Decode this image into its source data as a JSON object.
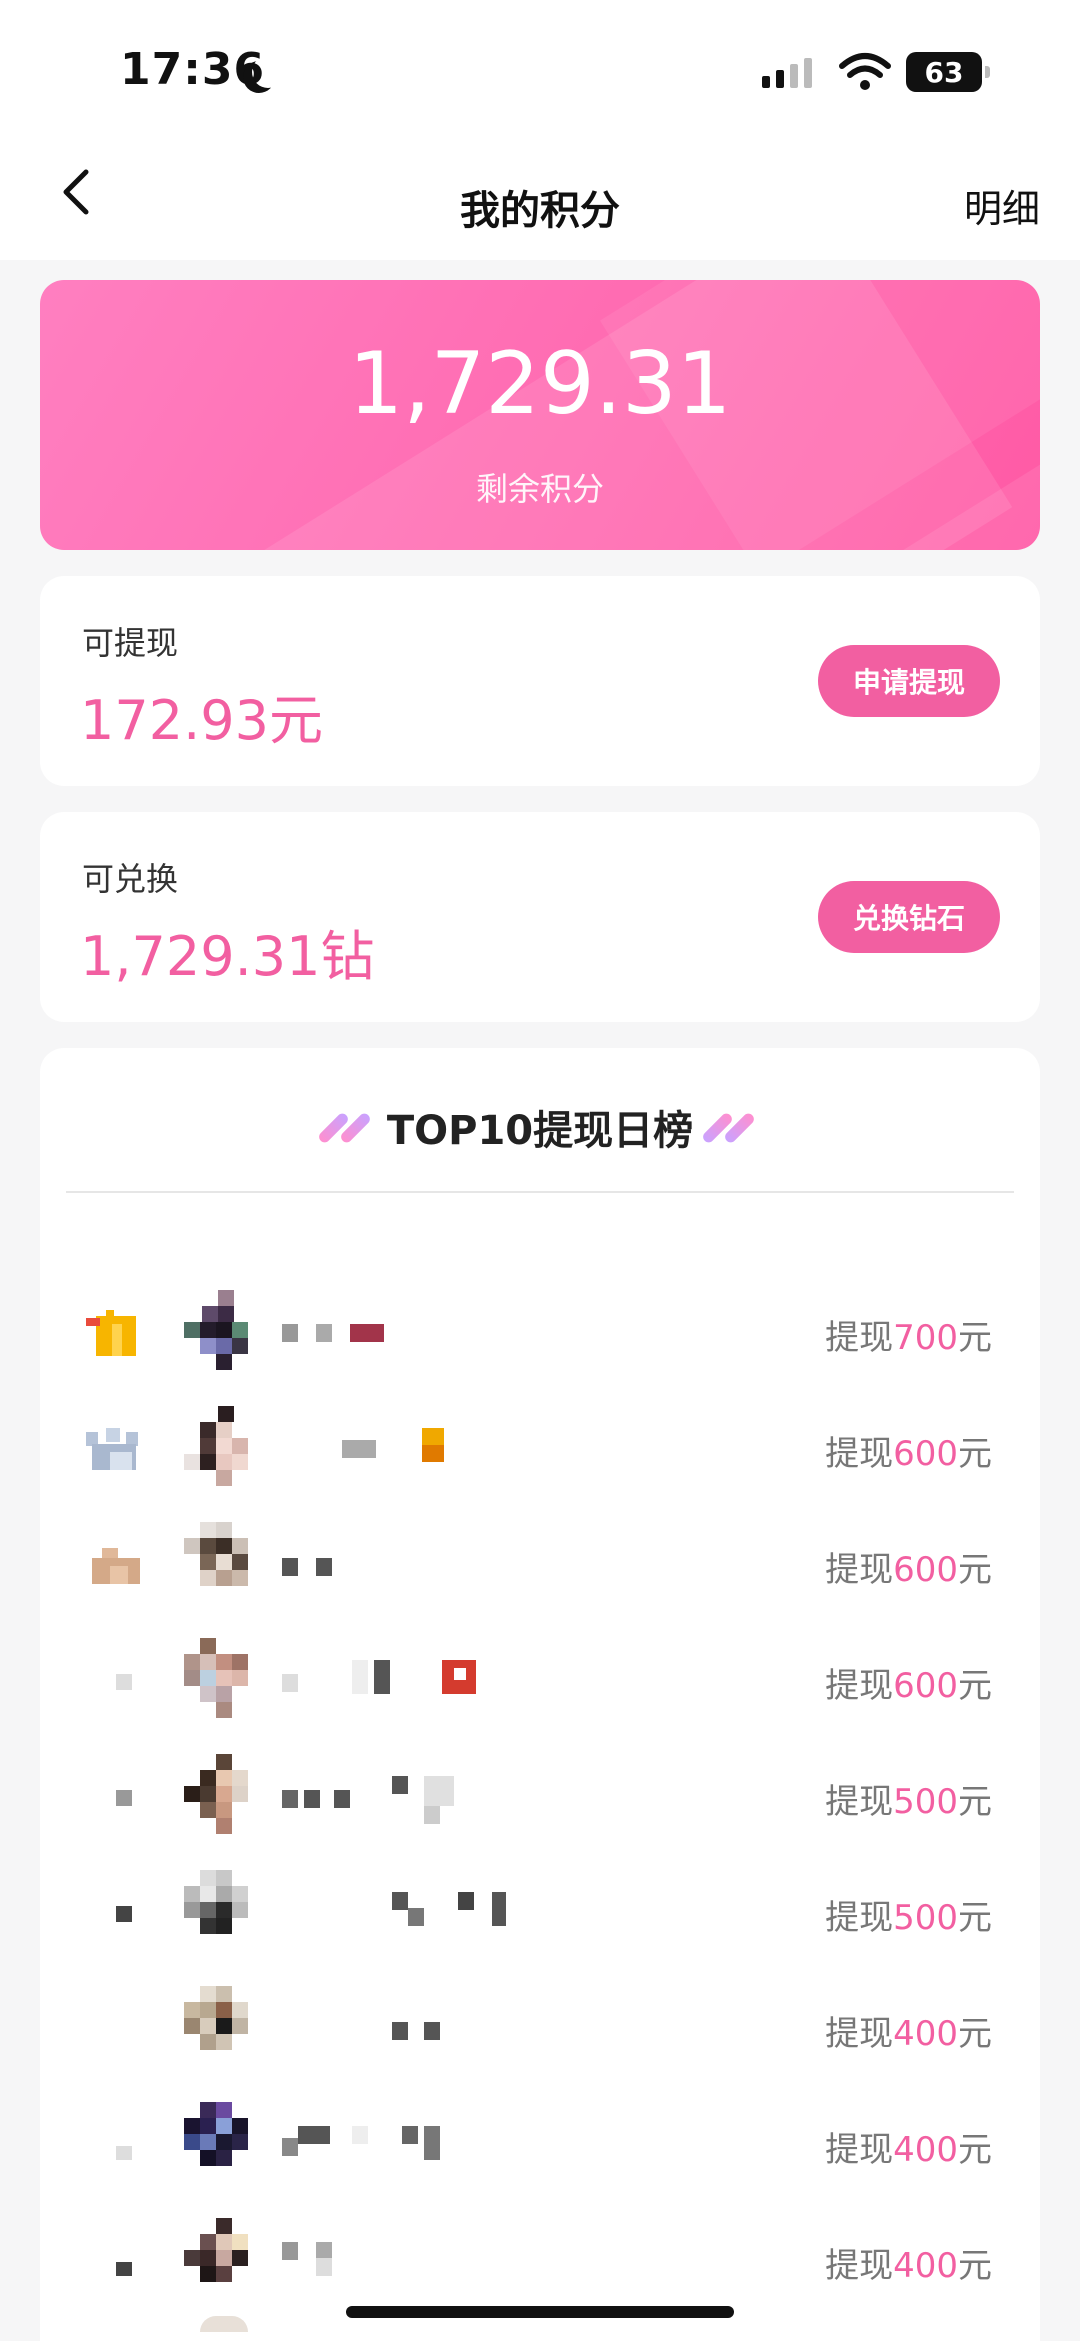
{
  "status_bar": {
    "time": "17:36",
    "battery": "63"
  },
  "nav": {
    "title": "我的积分",
    "detail_label": "明细"
  },
  "points": {
    "amount": "1,729.31",
    "label": "剩余积分"
  },
  "withdraw": {
    "label": "可提现",
    "value": "172.93元",
    "button": "申请提现"
  },
  "exchange": {
    "label": "可兑换",
    "value": "1,729.31钻",
    "button": "兑换钻石"
  },
  "ranking": {
    "title": "TOP10提现日榜",
    "rows": [
      {
        "prefix": "提现",
        "amount": "700",
        "unit": "元"
      },
      {
        "prefix": "提现",
        "amount": "600",
        "unit": "元"
      },
      {
        "prefix": "提现",
        "amount": "600",
        "unit": "元"
      },
      {
        "prefix": "提现",
        "amount": "600",
        "unit": "元"
      },
      {
        "prefix": "提现",
        "amount": "500",
        "unit": "元"
      },
      {
        "prefix": "提现",
        "amount": "500",
        "unit": "元"
      },
      {
        "prefix": "提现",
        "amount": "400",
        "unit": "元"
      },
      {
        "prefix": "提现",
        "amount": "400",
        "unit": "元"
      },
      {
        "prefix": "提现",
        "amount": "400",
        "unit": "元"
      }
    ]
  },
  "colors": {
    "accent": "#f25fa1",
    "hero_start": "#ff7fc0",
    "hero_end": "#ff5aa5"
  },
  "icons": {
    "back": "chevron-left-icon",
    "medal_1": "gold-crown-icon",
    "medal_2": "silver-crown-icon",
    "medal_3": "bronze-crown-icon"
  }
}
